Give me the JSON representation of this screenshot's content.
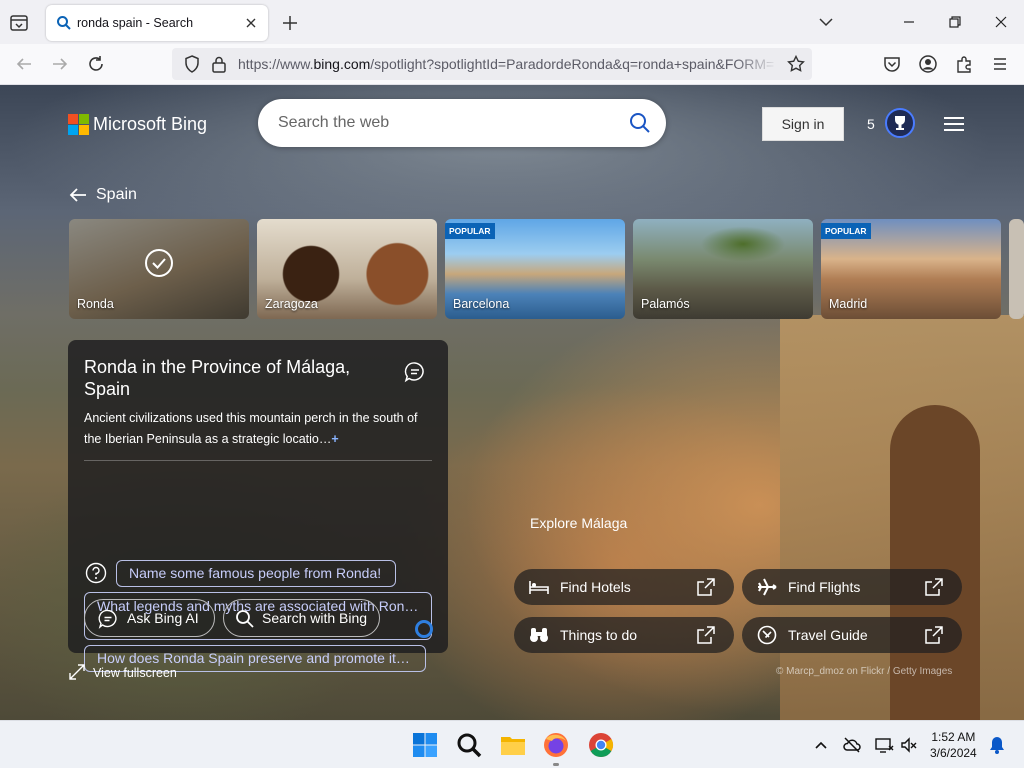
{
  "browser": {
    "tab_title": "ronda spain - Search",
    "url_prefix": "https://www.",
    "url_domain": "bing.com",
    "url_rest": "/spotlight?spotlightId=ParadordeRonda&q=ronda+spain&FORM="
  },
  "header": {
    "logo_text": "Microsoft Bing",
    "search_placeholder": "Search the web",
    "signin_label": "Sign in",
    "rewards_count": "5"
  },
  "breadcrumb": {
    "label": "Spain"
  },
  "cards": [
    {
      "label": "Ronda",
      "popular": ""
    },
    {
      "label": "Zaragoza",
      "popular": ""
    },
    {
      "label": "Barcelona",
      "popular": "POPULAR"
    },
    {
      "label": "Palamós",
      "popular": ""
    },
    {
      "label": "Madrid",
      "popular": "POPULAR"
    }
  ],
  "info": {
    "title": "Ronda in the Province of Málaga, Spain",
    "description": "Ancient civilizations used this mountain perch in the south of the Iberian Peninsula as a strategic locatio…",
    "expand_symbol": "+",
    "questions": [
      "Name some famous people from Ronda!",
      "What legends and myths are associated with Ron…",
      "How does Ronda Spain preserve and promote it…"
    ],
    "ask_label": "Ask Bing AI",
    "search_label": "Search with Bing"
  },
  "fullscreen_label": "View fullscreen",
  "explore": {
    "title": "Explore Málaga",
    "actions": [
      "Find Hotels",
      "Find Flights",
      "Things to do",
      "Travel Guide"
    ]
  },
  "credit": "© Marcp_dmoz on Flickr / Getty Images",
  "taskbar": {
    "time": "1:52 AM",
    "date": "3/6/2024"
  },
  "colors": {
    "accent": "#0b63b6",
    "rewards_ring": "#4a7cff",
    "pill_text": "#c7cdfa"
  }
}
